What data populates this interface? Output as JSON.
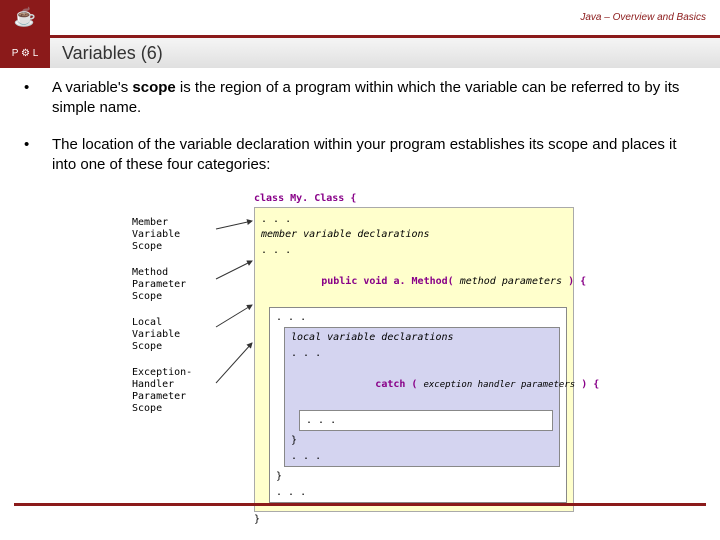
{
  "header": {
    "breadcrumb": "Java – Overview and Basics",
    "logo_top": "☕",
    "logo_bottom": "P ⚙ L"
  },
  "slide": {
    "title": "Variables (6)"
  },
  "bullets": [
    {
      "pre": "A variable's ",
      "strong": "scope",
      "post": " is the region of a program within which the variable can be referred to by its simple name."
    },
    {
      "pre": "The location of the variable declaration within your program establishes its scope and places it into one of these four categories:",
      "strong": "",
      "post": ""
    }
  ],
  "diagram": {
    "labels": [
      "Member Variable Scope",
      "Method Parameter Scope",
      "Local Variable Scope",
      "Exception-Handler Parameter Scope"
    ],
    "code": {
      "class_decl": "class My. Class {",
      "ellipsis": ". . .",
      "member_decl": "member variable declarations",
      "method_sig_pre": "public void a. Method( ",
      "method_sig_param": "method parameters",
      "method_sig_post": " ) {",
      "local_decl": "local variable declarations",
      "catch_pre": "catch ( ",
      "catch_param": "exception handler parameters",
      "catch_post": " ) {",
      "close": "}"
    }
  }
}
